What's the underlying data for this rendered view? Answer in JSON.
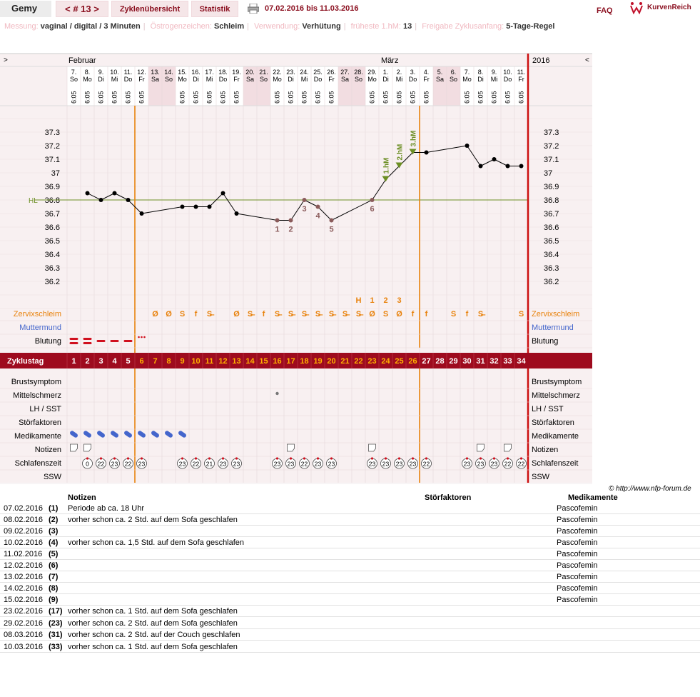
{
  "header": {
    "user": "Gemy",
    "cycle_nav": "< # 13 >",
    "tab_cycles": "Zyklenübersicht",
    "tab_stats": "Statistik",
    "date_range": "07.02.2016 bis 11.03.2016",
    "faq": "FAQ",
    "brand": "KurvenReich"
  },
  "meta": {
    "measure_label": "Messung:",
    "measure_value": "vaginal / digital / 3 Minuten",
    "estrogen_label": "Östrogenzeichen:",
    "estrogen_value": "Schleim",
    "usage_label": "Verwendung:",
    "usage_value": "Verhütung",
    "earliest_label": "früheste 1.hM:",
    "earliest_value": "13",
    "release_label": "Freigabe Zyklusanfang:",
    "release_value": "5-Tage-Regel"
  },
  "chart_data": {
    "type": "line",
    "month_left": "Februar",
    "month_right": "März",
    "year": "2016",
    "nav_left": ">",
    "nav_right": "<",
    "dates": [
      "7.",
      "8.",
      "9.",
      "10.",
      "11.",
      "12.",
      "13.",
      "14.",
      "15.",
      "16.",
      "17.",
      "18.",
      "19.",
      "20.",
      "21.",
      "22.",
      "23.",
      "24.",
      "25.",
      "26.",
      "27.",
      "28.",
      "29.",
      "1.",
      "2.",
      "3.",
      "4.",
      "5.",
      "6.",
      "7.",
      "8.",
      "9.",
      "10.",
      "11."
    ],
    "weekdays": [
      "So",
      "Mo",
      "Di",
      "Mi",
      "Do",
      "Fr",
      "Sa",
      "So",
      "Mo",
      "Di",
      "Mi",
      "Do",
      "Fr",
      "Sa",
      "So",
      "Mo",
      "Di",
      "Mi",
      "Do",
      "Fr",
      "Sa",
      "So",
      "Mo",
      "Di",
      "Mi",
      "Do",
      "Fr",
      "Sa",
      "So",
      "Mo",
      "Di",
      "Mi",
      "Do",
      "Fr"
    ],
    "times": [
      "6:05",
      "6:05",
      "6:05",
      "6:05",
      "6:05",
      "6:05",
      "",
      "",
      "6:05",
      "6:05",
      "6:05",
      "6:05",
      "6:05",
      "",
      "",
      "6:05",
      "6:05",
      "6:05",
      "6:05",
      "6:05",
      "",
      "",
      "6:05",
      "6:05",
      "6:05",
      "6:05",
      "6:05",
      "",
      "",
      "6:05",
      "6:05",
      "6:05",
      "6:05",
      "6:05"
    ],
    "weekend_days": [
      7,
      8,
      14,
      15,
      21,
      22,
      28,
      29
    ],
    "temps": [
      null,
      36.85,
      36.8,
      36.85,
      36.8,
      36.7,
      null,
      null,
      36.75,
      36.75,
      36.75,
      36.85,
      36.7,
      null,
      null,
      36.65,
      36.65,
      36.8,
      36.75,
      36.65,
      null,
      null,
      36.8,
      36.95,
      37.05,
      37.15,
      37.15,
      null,
      null,
      37.2,
      37.05,
      37.1,
      37.05,
      37.05
    ],
    "ylim": [
      36.1,
      37.4
    ],
    "yticks": [
      "37.3",
      "37.2",
      "37.1",
      "37",
      "36.9",
      "36.8",
      "36.7",
      "36.6",
      "36.5",
      "36.4",
      "36.3",
      "36.2"
    ],
    "hl_label": "HL",
    "hl_value": 36.8,
    "low_marks": [
      {
        "day": 16,
        "label": "1"
      },
      {
        "day": 17,
        "label": "2"
      },
      {
        "day": 18,
        "label": "3"
      },
      {
        "day": 19,
        "label": "4"
      },
      {
        "day": 20,
        "label": "5"
      },
      {
        "day": 23,
        "label": "6"
      }
    ],
    "high_marks": [
      {
        "day": 24,
        "label": "1.hM"
      },
      {
        "day": 25,
        "label": "2.hM"
      },
      {
        "day": 26,
        "label": "3.hM"
      }
    ],
    "peak_labels": [
      {
        "day": 22,
        "label": "H"
      },
      {
        "day": 23,
        "label": "1"
      },
      {
        "day": 24,
        "label": "2"
      },
      {
        "day": 25,
        "label": "3"
      }
    ],
    "mucus": [
      "",
      "",
      "",
      "",
      "",
      "",
      "Ø",
      "Ø",
      "S",
      "f",
      "S̶",
      "",
      "Ø",
      "S̶",
      "f",
      "S̶",
      "S̶",
      "S̶",
      "S̶",
      "S̶",
      "S̶",
      "S̶",
      "Ø",
      "S",
      "Ø",
      "f",
      "f",
      "",
      "S",
      "f",
      "S̶",
      "",
      "",
      "S"
    ],
    "cycle_days": [
      "1",
      "2",
      "3",
      "4",
      "5",
      "6",
      "7",
      "8",
      "9",
      "10",
      "11",
      "12",
      "13",
      "14",
      "15",
      "16",
      "17",
      "18",
      "19",
      "20",
      "21",
      "22",
      "23",
      "24",
      "25",
      "26",
      "27",
      "28",
      "29",
      "30",
      "31",
      "32",
      "33",
      "34"
    ],
    "sleep": [
      "",
      "0",
      "22",
      "23",
      "22",
      "23",
      "",
      "",
      "23",
      "22",
      "21",
      "23",
      "23",
      "",
      "",
      "23",
      "23",
      "22",
      "23",
      "23",
      "",
      "",
      "23",
      "23",
      "23",
      "23",
      "22",
      "",
      "",
      "23",
      "23",
      "23",
      "22",
      "22"
    ]
  },
  "rows": {
    "zervix": "Zervixschleim",
    "muttermund": "Muttermund",
    "blutung": "Blutung",
    "zyklustag": "Zyklustag",
    "brust": "Brustsymptom",
    "mittel": "Mittelschmerz",
    "lh": "LH / SST",
    "stoer": "Störfaktoren",
    "medi": "Medikamente",
    "notizen": "Notizen",
    "schlaf": "Schlafenszeit",
    "ssw": "SSW"
  },
  "colors": {
    "accent": "#9e0b1e",
    "orange": "#e8820c",
    "green": "#6b8e23",
    "bg_pink": "#f8f0f1",
    "blue": "#4466cc"
  },
  "copyright": "© http://www.nfp-forum.de",
  "notes_table": {
    "head_notes": "Notizen",
    "head_stoer": "Störfaktoren",
    "head_medi": "Medikamente",
    "rows": [
      {
        "date": "07.02.2016",
        "day": "(1)",
        "note": "Periode ab ca. 18 Uhr",
        "med": "Pascofemin"
      },
      {
        "date": "08.02.2016",
        "day": "(2)",
        "note": "vorher schon ca. 2 Std. auf dem Sofa geschlafen",
        "med": "Pascofemin"
      },
      {
        "date": "09.02.2016",
        "day": "(3)",
        "note": "",
        "med": "Pascofemin"
      },
      {
        "date": "10.02.2016",
        "day": "(4)",
        "note": "vorher schon ca. 1,5 Std. auf dem Sofa geschlafen",
        "med": "Pascofemin"
      },
      {
        "date": "11.02.2016",
        "day": "(5)",
        "note": "",
        "med": "Pascofemin"
      },
      {
        "date": "12.02.2016",
        "day": "(6)",
        "note": "",
        "med": "Pascofemin"
      },
      {
        "date": "13.02.2016",
        "day": "(7)",
        "note": "",
        "med": "Pascofemin"
      },
      {
        "date": "14.02.2016",
        "day": "(8)",
        "note": "",
        "med": "Pascofemin"
      },
      {
        "date": "15.02.2016",
        "day": "(9)",
        "note": "",
        "med": "Pascofemin"
      },
      {
        "date": "23.02.2016",
        "day": "(17)",
        "note": "vorher schon ca. 1 Std. auf dem Sofa geschlafen",
        "med": ""
      },
      {
        "date": "29.02.2016",
        "day": "(23)",
        "note": "vorher schon ca. 2 Std. auf dem Sofa geschlafen",
        "med": ""
      },
      {
        "date": "08.03.2016",
        "day": "(31)",
        "note": "vorher schon ca. 2 Std. auf der Couch geschlafen",
        "med": ""
      },
      {
        "date": "10.03.2016",
        "day": "(33)",
        "note": "vorher schon ca. 1 Std. auf dem Sofa geschlafen",
        "med": ""
      }
    ]
  }
}
